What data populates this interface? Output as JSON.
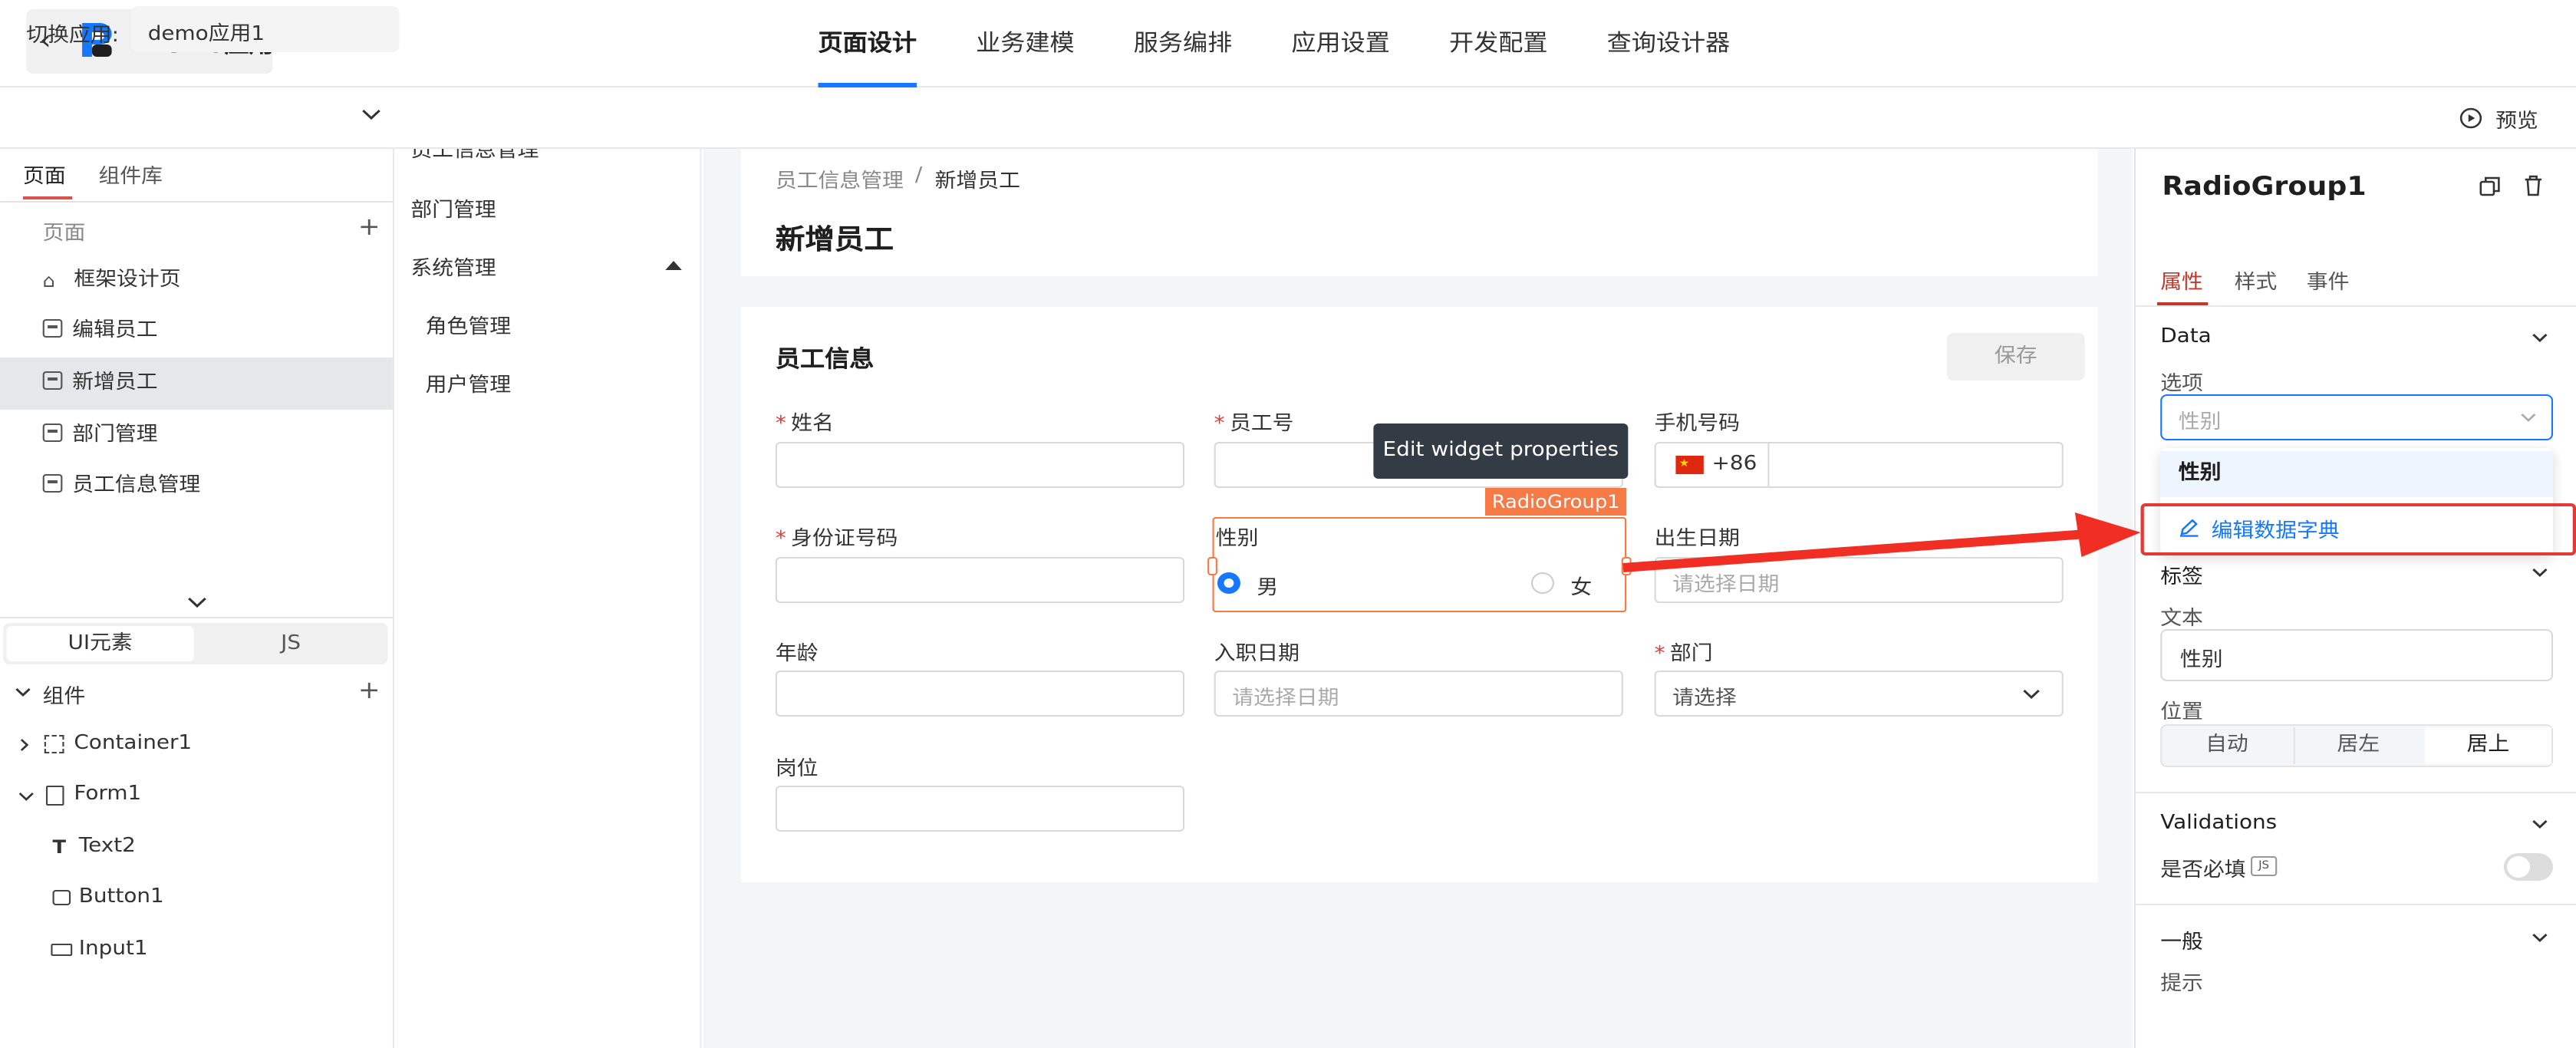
{
  "header": {
    "back_glyph": "‹",
    "app_title": "Demo应用",
    "nav": [
      "页面设计",
      "业务建模",
      "服务编排",
      "应用设置",
      "开发配置",
      "查询设计器"
    ],
    "active_nav": "页面设计"
  },
  "subbar": {
    "switch_label": "切换应用:",
    "switch_value": "demo应用1",
    "preview_label": "预览"
  },
  "left": {
    "tabs": [
      "页面",
      "组件库"
    ],
    "pages_header": "页面",
    "pages": [
      {
        "label": "框架设计页",
        "icon": "home-icon"
      },
      {
        "label": "编辑员工",
        "icon": "page-icon"
      },
      {
        "label": "新增员工",
        "icon": "page-icon",
        "selected": true
      },
      {
        "label": "部门管理",
        "icon": "page-icon"
      },
      {
        "label": "员工信息管理",
        "icon": "page-icon"
      }
    ],
    "seg": [
      "UI元素",
      "JS"
    ],
    "tree_header": "组件",
    "tree": [
      {
        "label": "Container1",
        "icon": "container-icon"
      },
      {
        "label": "Form1",
        "icon": "form-icon"
      },
      {
        "label": "Text2",
        "icon": "text-icon"
      },
      {
        "label": "Button1",
        "icon": "button-icon"
      },
      {
        "label": "Input1",
        "icon": "input-icon"
      }
    ]
  },
  "menu": {
    "items": [
      "员工信息管理",
      "部门管理",
      "系统管理",
      "角色管理",
      "用户管理"
    ]
  },
  "canvas": {
    "breadcrumb": [
      "员工信息管理",
      "新增员工"
    ],
    "breadcrumb_sep": "/",
    "page_title": "新增员工",
    "section_title": "员工信息",
    "save_label": "保存",
    "fields": {
      "name": "姓名",
      "emp_no": "员工号",
      "phone": "手机号码",
      "phone_prefix": "+86",
      "id_no": "身份证号码",
      "gender": "性别",
      "male": "男",
      "female": "女",
      "birth": "出生日期",
      "birth_ph": "请选择日期",
      "age": "年龄",
      "hire": "入职日期",
      "hire_ph": "请选择日期",
      "dept": "部门",
      "dept_ph": "请选择",
      "post": "岗位"
    },
    "tooltip": "Edit widget properties",
    "widget_tag": "RadioGroup1"
  },
  "right": {
    "title": "RadioGroup1",
    "tabs": [
      "属性",
      "样式",
      "事件"
    ],
    "data_section": "Data",
    "options_label": "选项",
    "options_placeholder": "性别",
    "dropdown_option": "性别",
    "edit_dict": "编辑数据字典",
    "label_section": "标签",
    "text_label": "文本",
    "text_value": "性别",
    "position_label": "位置",
    "positions": [
      "自动",
      "居左",
      "居上"
    ],
    "validations_section": "Validations",
    "required_label": "是否必填",
    "required_badge": "JS",
    "general_section": "一般",
    "hint_label": "提示"
  },
  "colors": {
    "accent": "#1677ff",
    "highlight": "#e53935",
    "widget": "#f57a46"
  }
}
